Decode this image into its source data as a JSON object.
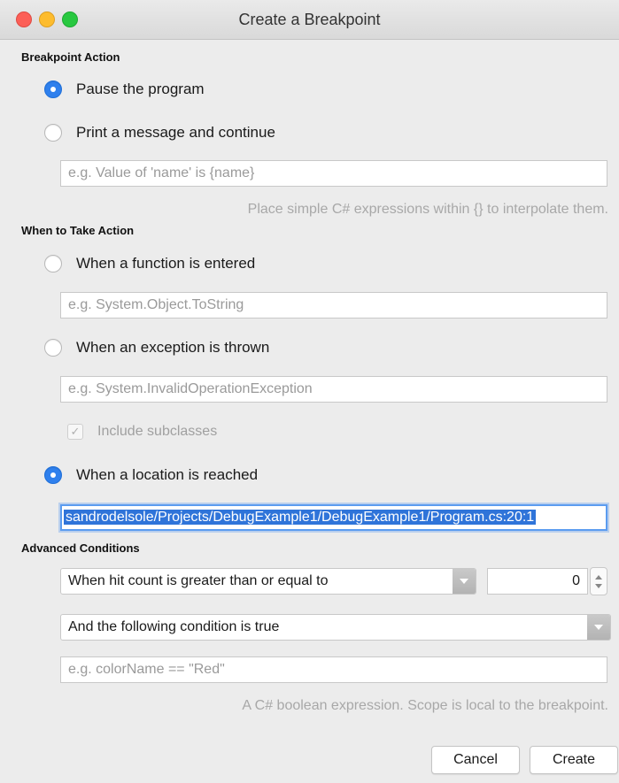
{
  "window": {
    "title": "Create a Breakpoint"
  },
  "breakpoint_action": {
    "heading": "Breakpoint Action",
    "pause_label": "Pause the program",
    "print_label": "Print a message and continue",
    "message_placeholder": "e.g. Value of 'name' is {name}",
    "message_hint": "Place simple C# expressions within {} to interpolate them.",
    "selected": "pause"
  },
  "when_to_take_action": {
    "heading": "When to Take Action",
    "function_label": "When a function is entered",
    "function_placeholder": "e.g. System.Object.ToString",
    "exception_label": "When an exception is thrown",
    "exception_placeholder": "e.g. System.InvalidOperationException",
    "include_subclasses_label": "Include subclasses",
    "include_subclasses_checked": true,
    "location_label": "When a location is reached",
    "location_value": "sandrodelsole/Projects/DebugExample1/DebugExample1/Program.cs:20:1",
    "selected": "location"
  },
  "advanced_conditions": {
    "heading": "Advanced Conditions",
    "hit_count_option": "When hit count is greater than or equal to",
    "hit_count_value": "0",
    "condition_option": "And the following condition is true",
    "condition_placeholder": "e.g. colorName == \"Red\"",
    "condition_hint": "A C# boolean expression. Scope is local to the breakpoint."
  },
  "buttons": {
    "cancel": "Cancel",
    "create": "Create"
  },
  "colors": {
    "accent": "#2f80ed",
    "selection": "#2f74d9"
  }
}
